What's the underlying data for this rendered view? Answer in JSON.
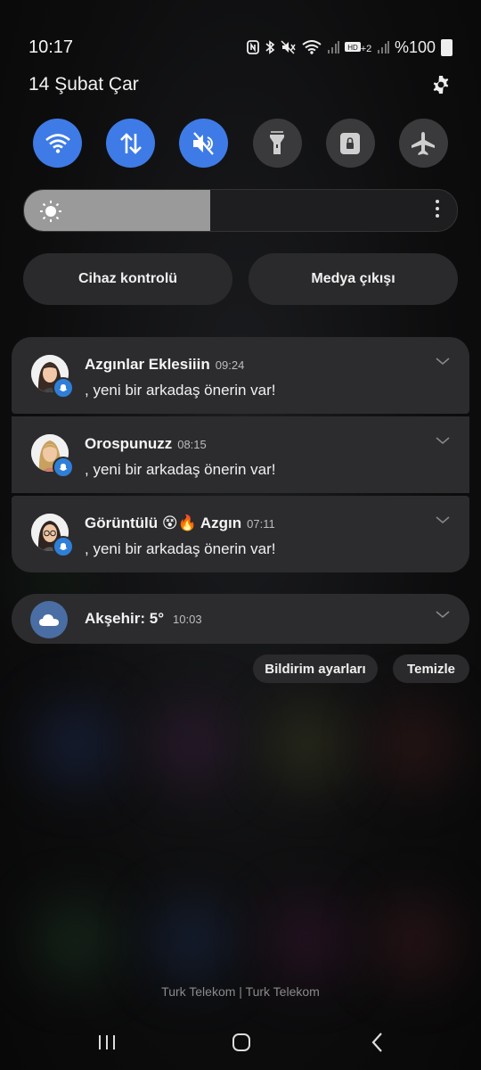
{
  "status_bar": {
    "time": "10:17",
    "battery": "%100",
    "icons": [
      "nfc-icon",
      "bluetooth-icon",
      "mute-icon",
      "wifi-icon",
      "signal-icon",
      "volte-icon",
      "signal-icon",
      "battery-icon"
    ]
  },
  "header": {
    "date": "14 Şubat Çar",
    "settings_icon": "gear-icon"
  },
  "quick_toggles": [
    {
      "name": "wifi",
      "icon": "wifi-icon",
      "state": "on"
    },
    {
      "name": "mobile-data",
      "icon": "data-arrows-icon",
      "state": "on"
    },
    {
      "name": "sound",
      "icon": "mute-icon",
      "state": "on"
    },
    {
      "name": "flashlight",
      "icon": "flashlight-icon",
      "state": "off"
    },
    {
      "name": "rotation-lock",
      "icon": "lock-icon",
      "state": "off"
    },
    {
      "name": "airplane",
      "icon": "airplane-icon",
      "state": "off"
    }
  ],
  "brightness": {
    "level": 0.43
  },
  "buttons": {
    "device_control": "Cihaz kontrolü",
    "media_output": "Medya çıkışı"
  },
  "notifications": [
    {
      "title": "Azgınlar Eklesiiin",
      "time": "09:24",
      "body": ", yeni bir arkadaş önerin var!"
    },
    {
      "title": "Orospunuzz",
      "time": "08:15",
      "body": ", yeni bir arkadaş önerin var!"
    },
    {
      "title": "Görüntülü 😵🔥 Azgın",
      "time": "07:11",
      "body": ", yeni bir arkadaş önerin var!"
    }
  ],
  "weather": {
    "place": "Akşehir: 5°",
    "time": "10:03"
  },
  "actions": {
    "notification_settings": "Bildirim ayarları",
    "clear": "Temizle"
  },
  "carrier": "Turk Telekom | Turk Telekom",
  "colors": {
    "accent": "#3e7be6",
    "panel": "#2c2c2e",
    "badge": "#2f7fd8"
  }
}
